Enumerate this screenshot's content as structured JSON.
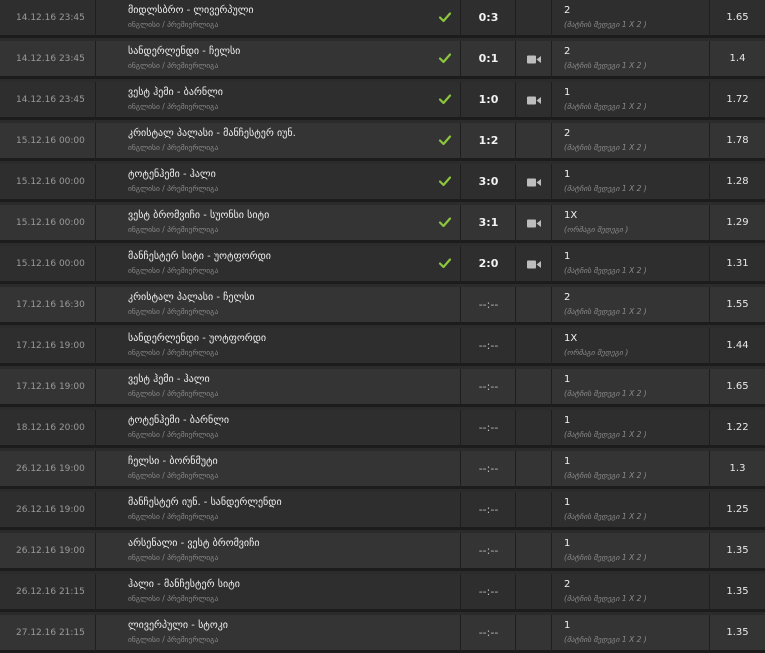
{
  "colors": {
    "check": "#8cc63f",
    "camera": "#bdbdbd"
  },
  "rows": [
    {
      "date": "14.12.16 23:45",
      "teams": "მიდლსბრო - ლივერპული",
      "league": "ინგლისი / პრემიერლიგა",
      "finished": true,
      "score": "0:3",
      "video": false,
      "pick": "2",
      "pick_desc": "(მატჩის შედეგი 1 X 2 )",
      "odds": "1.65"
    },
    {
      "date": "14.12.16 23:45",
      "teams": "სანდერლენდი - ჩელსი",
      "league": "ინგლისი / პრემიერლიგა",
      "finished": true,
      "score": "0:1",
      "video": true,
      "pick": "2",
      "pick_desc": "(მატჩის შედეგი 1 X 2 )",
      "odds": "1.4"
    },
    {
      "date": "14.12.16 23:45",
      "teams": "ვესტ ჰემი - ბარნლი",
      "league": "ინგლისი / პრემიერლიგა",
      "finished": true,
      "score": "1:0",
      "video": true,
      "pick": "1",
      "pick_desc": "(მატჩის შედეგი 1 X 2 )",
      "odds": "1.72"
    },
    {
      "date": "15.12.16 00:00",
      "teams": "კრისტალ პალასი - მანჩესტერ იუნ.",
      "league": "ინგლისი / პრემიერლიგა",
      "finished": true,
      "score": "1:2",
      "video": false,
      "pick": "2",
      "pick_desc": "(მატჩის შედეგი 1 X 2 )",
      "odds": "1.78"
    },
    {
      "date": "15.12.16 00:00",
      "teams": "ტოტენჰემი - ჰალი",
      "league": "ინგლისი / პრემიერლიგა",
      "finished": true,
      "score": "3:0",
      "video": true,
      "pick": "1",
      "pick_desc": "(მატჩის შედეგი 1 X 2 )",
      "odds": "1.28"
    },
    {
      "date": "15.12.16 00:00",
      "teams": "ვესტ ბრომვიჩი - სუონსი სიტი",
      "league": "ინგლისი / პრემიერლიგა",
      "finished": true,
      "score": "3:1",
      "video": true,
      "pick": "1X",
      "pick_desc": "(ორმაგი შედეგი )",
      "odds": "1.29"
    },
    {
      "date": "15.12.16 00:00",
      "teams": "მანჩესტერ სიტი - უოტფორდი",
      "league": "ინგლისი / პრემიერლიგა",
      "finished": true,
      "score": "2:0",
      "video": true,
      "pick": "1",
      "pick_desc": "(მატჩის შედეგი 1 X 2 )",
      "odds": "1.31"
    },
    {
      "date": "17.12.16 16:30",
      "teams": "კრისტალ პალასი - ჩელსი",
      "league": "ინგლისი / პრემიერლიგა",
      "finished": false,
      "score": "--:--",
      "video": false,
      "pick": "2",
      "pick_desc": "(მატჩის შედეგი 1 X 2 )",
      "odds": "1.55"
    },
    {
      "date": "17.12.16 19:00",
      "teams": "სანდერლენდი - უოტფორდი",
      "league": "ინგლისი / პრემიერლიგა",
      "finished": false,
      "score": "--:--",
      "video": false,
      "pick": "1X",
      "pick_desc": "(ორმაგი შედეგი )",
      "odds": "1.44"
    },
    {
      "date": "17.12.16 19:00",
      "teams": "ვესტ ჰემი - ჰალი",
      "league": "ინგლისი / პრემიერლიგა",
      "finished": false,
      "score": "--:--",
      "video": false,
      "pick": "1",
      "pick_desc": "(მატჩის შედეგი 1 X 2 )",
      "odds": "1.65"
    },
    {
      "date": "18.12.16 20:00",
      "teams": "ტოტენჰემი - ბარნლი",
      "league": "ინგლისი / პრემიერლიგა",
      "finished": false,
      "score": "--:--",
      "video": false,
      "pick": "1",
      "pick_desc": "(მატჩის შედეგი 1 X 2 )",
      "odds": "1.22"
    },
    {
      "date": "26.12.16 19:00",
      "teams": "ჩელსი - ბორნმუტი",
      "league": "ინგლისი / პრემიერლიგა",
      "finished": false,
      "score": "--:--",
      "video": false,
      "pick": "1",
      "pick_desc": "(მატჩის შედეგი 1 X 2 )",
      "odds": "1.3"
    },
    {
      "date": "26.12.16 19:00",
      "teams": "მანჩესტერ იუნ. - სანდერლენდი",
      "league": "ინგლისი / პრემიერლიგა",
      "finished": false,
      "score": "--:--",
      "video": false,
      "pick": "1",
      "pick_desc": "(მატჩის შედეგი 1 X 2 )",
      "odds": "1.25"
    },
    {
      "date": "26.12.16 19:00",
      "teams": "არსენალი - ვესტ ბრომვიჩი",
      "league": "ინგლისი / პრემიერლიგა",
      "finished": false,
      "score": "--:--",
      "video": false,
      "pick": "1",
      "pick_desc": "(მატჩის შედეგი 1 X 2 )",
      "odds": "1.35"
    },
    {
      "date": "26.12.16 21:15",
      "teams": "ჰალი - მანჩესტერ სიტი",
      "league": "ინგლისი / პრემიერლიგა",
      "finished": false,
      "score": "--:--",
      "video": false,
      "pick": "2",
      "pick_desc": "(მატჩის შედეგი 1 X 2 )",
      "odds": "1.35"
    },
    {
      "date": "27.12.16 21:15",
      "teams": "ლივერპული - სტოკი",
      "league": "ინგლისი / პრემიერლიგა",
      "finished": false,
      "score": "--:--",
      "video": false,
      "pick": "1",
      "pick_desc": "(მატჩის შედეგი 1 X 2 )",
      "odds": "1.35"
    }
  ]
}
